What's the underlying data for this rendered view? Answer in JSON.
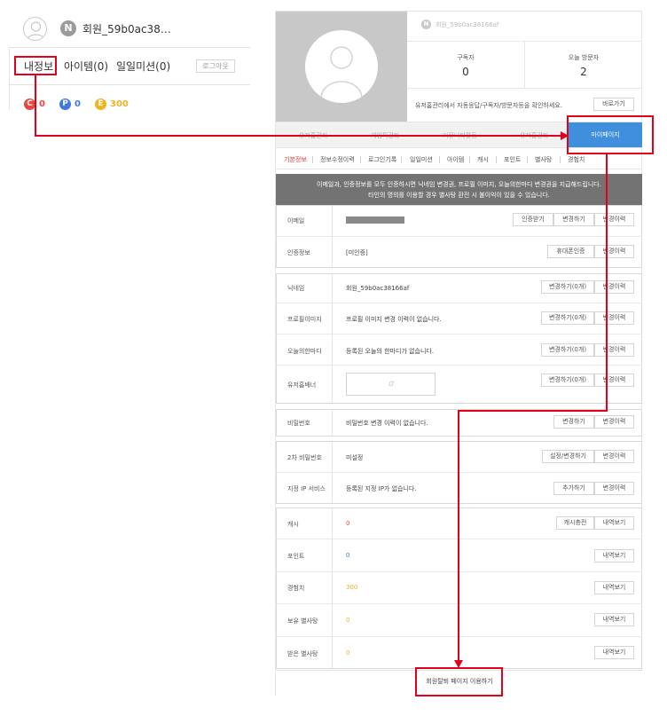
{
  "left_panel": {
    "level_badge": "N",
    "user_name": "회원_59b0ac38…",
    "tabs": [
      "내정보",
      "아이템(0)",
      "일일미션(0)"
    ],
    "logout_label": "로그아웃",
    "currencies": [
      {
        "icon": "C",
        "value": "0",
        "color": "#e8473f"
      },
      {
        "icon": "P",
        "value": "0",
        "color": "#3f78e0"
      },
      {
        "icon": "E",
        "value": "300",
        "color": "#f0b322"
      }
    ]
  },
  "profile": {
    "badge": "N",
    "name": "회원_59b0ac38166af",
    "subscribers_label": "구독자",
    "subscribers_value": "0",
    "visitors_label": "오늘 방문자",
    "visitors_value": "2",
    "info_text": "유저홈관리에서 자동응답/구독자/방문자등을 확인하세요.",
    "shortcut_label": "바로가기"
  },
  "main_tabs": [
    "유저홈관리",
    "게임픽관리",
    "커뮤니티활동",
    "유저홈관리"
  ],
  "mypage_label": "마이페이지",
  "sub_tabs": [
    "기본정보",
    "정보수정이력",
    "로그인기록",
    "일일미션",
    "아이템",
    "캐시",
    "포인트",
    "별사탕",
    "경험치"
  ],
  "notice": {
    "line1": "이메일과, 인증정보를 모두 인증하시면 닉네임 변경권, 프로필 이미지, 오늘의한마디 변경권을 지급해드립니다.",
    "line2": "타인의 명의를 이용할 경우 별사탕 환전 시 불이익이 있을 수 있습니다."
  },
  "rows": {
    "email": {
      "label": "이메일",
      "btn1": "인증받기",
      "btn2": "변경하기",
      "btn3": "변경이력"
    },
    "auth": {
      "label": "인증정보",
      "value": "[미인증]",
      "btn1": "휴대폰인증",
      "btn2": "변경이력"
    },
    "nickname": {
      "label": "닉네임",
      "value": "회원_59b0ac38166af",
      "btn1": "변경하기(0개)",
      "btn2": "변경이력"
    },
    "profile_img": {
      "label": "프로필이미지",
      "value": "프로필 이미지 변경 이력이 없습니다.",
      "btn1": "변경하기(0개)",
      "btn2": "변경이력"
    },
    "today_word": {
      "label": "오늘의한마디",
      "value": "등록된 오늘의 한마디가 없습니다.",
      "btn1": "변경하기(0개)",
      "btn2": "변경이력"
    },
    "banner": {
      "label": "유저홈배너",
      "placeholder": "ꭤ",
      "btn1": "변경하기(0개)",
      "btn2": "변경이력"
    },
    "password": {
      "label": "비밀번호",
      "value": "비밀번호 변경 이력이 없습니다.",
      "btn1": "변경하기",
      "btn2": "변경이력"
    },
    "second_pw": {
      "label": "2차 비밀번호",
      "value": "미설정",
      "btn1": "설정/변경하기",
      "btn2": "변경이력"
    },
    "ip_service": {
      "label": "지정 IP 서비스",
      "value": "등록된 지정 IP가 없습니다.",
      "btn1": "추가하기",
      "btn2": "변경이력"
    },
    "cash": {
      "label": "캐시",
      "value": "0",
      "btn1": "캐시충전",
      "btn2": "내역보기"
    },
    "point": {
      "label": "포인트",
      "value": "0",
      "btn1": "내역보기"
    },
    "exp": {
      "label": "경험치",
      "value": "300",
      "btn1": "내역보기"
    },
    "stars_own": {
      "label": "보유 별사탕",
      "value": "0",
      "btn1": "내역보기"
    },
    "stars_recv": {
      "label": "받은 별사탕",
      "value": "0",
      "btn1": "내역보기"
    }
  },
  "bottom_link": "회원탈퇴 페이지 이용하기",
  "colors": {
    "accent_red": "#e3001b",
    "mypage_blue": "#3f8fdc",
    "cash_red": "#e8473f",
    "point_blue": "#3f78e0",
    "exp_gold": "#f0b322"
  }
}
